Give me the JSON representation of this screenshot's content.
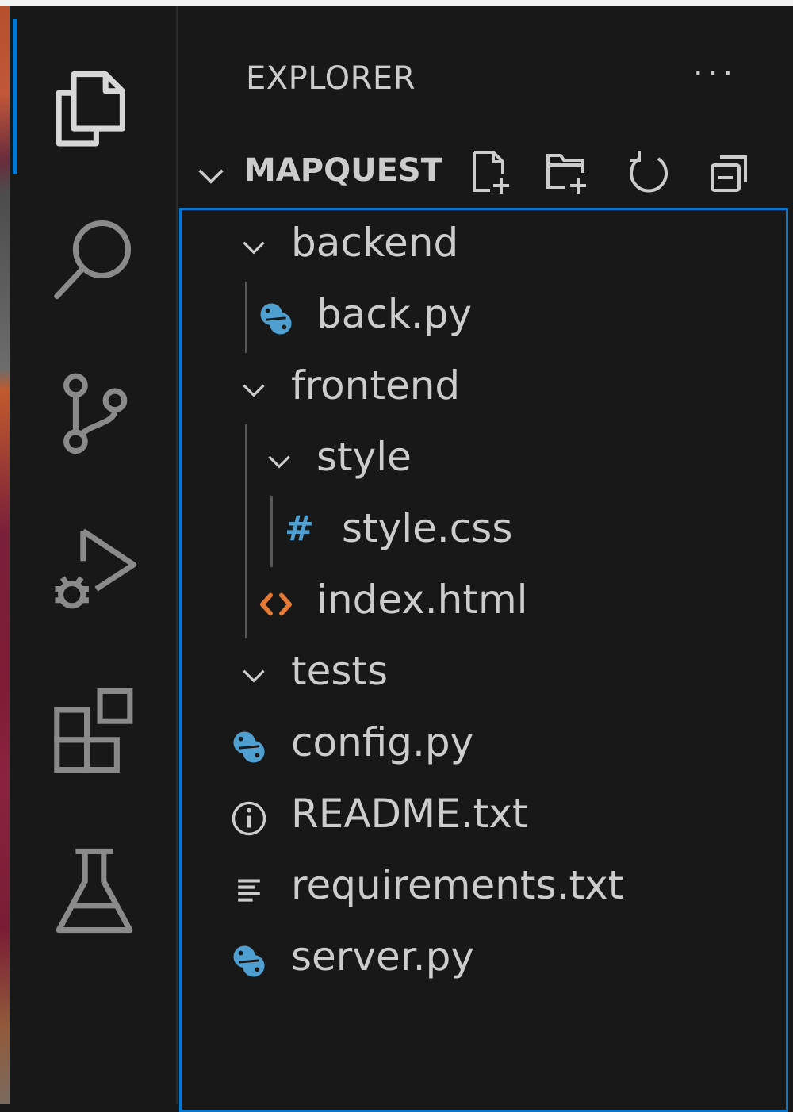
{
  "explorer": {
    "title": "EXPLORER",
    "more_actions": "···",
    "root": "MAPQUEST",
    "root_actions": [
      "new-file",
      "new-folder",
      "refresh",
      "collapse-all"
    ]
  },
  "activity_bar": [
    "explorer",
    "search",
    "source-control",
    "run-and-debug",
    "extensions",
    "testing"
  ],
  "tree": [
    {
      "label": "backend",
      "type": "folder",
      "expanded": true
    },
    {
      "label": "back.py",
      "type": "python"
    },
    {
      "label": "frontend",
      "type": "folder",
      "expanded": true
    },
    {
      "label": "style",
      "type": "folder",
      "expanded": true
    },
    {
      "label": "style.css",
      "type": "css",
      "icon_glyph": "#"
    },
    {
      "label": "index.html",
      "type": "html"
    },
    {
      "label": "tests",
      "type": "folder",
      "expanded": true
    },
    {
      "label": "config.py",
      "type": "python"
    },
    {
      "label": "README.txt",
      "type": "info"
    },
    {
      "label": "requirements.txt",
      "type": "text"
    },
    {
      "label": "server.py",
      "type": "python"
    }
  ],
  "colors": {
    "accent": "#0078d4",
    "background": "#181818",
    "text": "#cccccc",
    "python_icon": "#4f9fd0",
    "css_icon": "#4f9fd0",
    "html_icon": "#e37933"
  }
}
